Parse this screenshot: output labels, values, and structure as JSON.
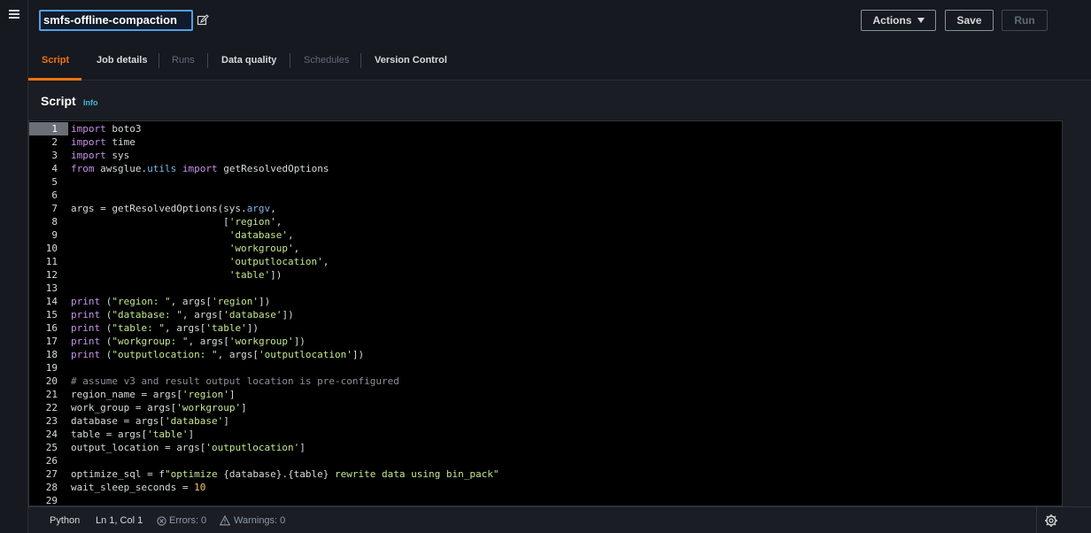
{
  "header": {
    "job_name": "smfs-offline-compaction",
    "actions_label": "Actions",
    "save_label": "Save",
    "run_label": "Run"
  },
  "tabs": [
    {
      "label": "Script",
      "state": "active"
    },
    {
      "label": "Job details",
      "state": "enabled"
    },
    {
      "label": "Runs",
      "state": "disabled"
    },
    {
      "label": "Data quality",
      "state": "enabled"
    },
    {
      "label": "Schedules",
      "state": "disabled"
    },
    {
      "label": "Version Control",
      "state": "enabled"
    }
  ],
  "script_panel": {
    "title": "Script",
    "info_label": "Info"
  },
  "editor": {
    "current_line": 1,
    "line_numbers": [
      "1",
      "2",
      "3",
      "4",
      "5",
      "6",
      "7",
      "8",
      "9",
      "10",
      "11",
      "12",
      "13",
      "14",
      "15",
      "16",
      "17",
      "18",
      "19",
      "20",
      "21",
      "22",
      "23",
      "24",
      "25",
      "26",
      "27",
      "28",
      "29"
    ],
    "lines": [
      "import boto3",
      "import time",
      "import sys",
      "from awsglue.utils import getResolvedOptions",
      "",
      "",
      "args = getResolvedOptions(sys.argv,",
      "                          ['region',",
      "                           'database',",
      "                           'workgroup',",
      "                           'outputlocation',",
      "                           'table'])",
      "",
      "print (\"region: \", args['region'])",
      "print (\"database: \", args['database'])",
      "print (\"table: \", args['table'])",
      "print (\"workgroup: \", args['workgroup'])",
      "print (\"outputlocation: \", args['outputlocation'])",
      "",
      "# assume v3 and result output location is pre-configured",
      "region_name = args['region']",
      "work_group = args['workgroup']",
      "database = args['database']",
      "table = args['table']",
      "output_location = args['outputlocation']",
      "",
      "optimize_sql = f\"optimize {database}.{table} rewrite data using bin_pack\"",
      "wait_sleep_seconds = 10",
      ""
    ]
  },
  "status": {
    "language": "Python",
    "position": "Ln 1, Col 1",
    "errors": "Errors: 0",
    "warnings": "Warnings: 0"
  },
  "colors": {
    "accent": "#ec7211",
    "focus": "#539fe5",
    "info": "#44b9d6",
    "keyword": "#c792ea",
    "string": "#c3e88d",
    "attribute": "#7fb7e6",
    "comment": "#8b9098",
    "number": "#f3c969"
  },
  "icons": {
    "menu": "hamburger-icon",
    "edit": "edit-icon",
    "actions_caret": "caret-down-icon",
    "errors": "error-circle-icon",
    "warnings": "warning-triangle-icon",
    "settings": "gear-icon"
  }
}
